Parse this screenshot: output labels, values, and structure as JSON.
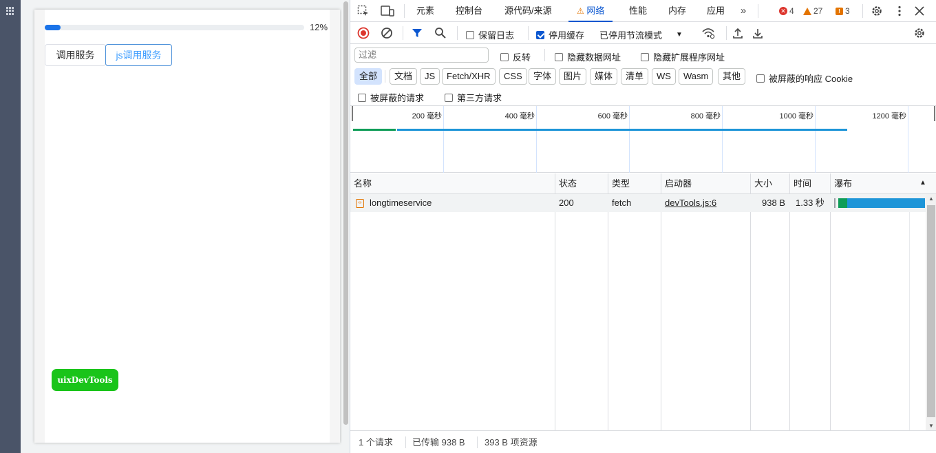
{
  "preview": {
    "progress": {
      "fraction": 0.12,
      "label": "12%"
    },
    "buttons": {
      "call_service": "调用服务",
      "js_call_service": "js调用服务"
    },
    "uix_button": "uixDevTools"
  },
  "devtools": {
    "tabs": [
      "元素",
      "控制台",
      "源代码/来源",
      "网络",
      "性能",
      "内存",
      "应用"
    ],
    "active_tab": "网络",
    "badges": {
      "errors": "4",
      "warnings": "27",
      "issues": "3"
    },
    "toolbar": {
      "preserve_log": "保留日志",
      "disable_cache": "停用缓存",
      "throttling": "已停用节流模式"
    },
    "filter": {
      "placeholder": "过滤",
      "invert": "反转",
      "hide_data_urls": "隐藏数据网址",
      "hide_extension_urls": "隐藏扩展程序网址",
      "chips": [
        "全部",
        "文档",
        "JS",
        "Fetch/XHR",
        "CSS",
        "字体",
        "图片",
        "媒体",
        "清单",
        "WS",
        "Wasm",
        "其他"
      ],
      "blocked_cookies": "被屏蔽的响应 Cookie",
      "blocked_requests": "被屏蔽的请求",
      "third_party": "第三方请求"
    },
    "timeline": {
      "ticks": [
        "200 毫秒",
        "400 毫秒",
        "600 毫秒",
        "800 毫秒",
        "1000 毫秒",
        "1200 毫秒"
      ]
    },
    "table": {
      "columns": {
        "name": "名称",
        "status": "状态",
        "type": "类型",
        "initiator": "启动器",
        "size": "大小",
        "time": "时间",
        "waterfall": "瀑布"
      },
      "rows": [
        {
          "name": "longtimeservice",
          "status": "200",
          "type": "fetch",
          "initiator": "devTools.js:6",
          "size": "938 B",
          "time": "1.33 秒"
        }
      ]
    },
    "status": {
      "requests": "1 个请求",
      "transferred": "已传输 938 B",
      "resources": "393 B 项资源"
    }
  },
  "colors": {
    "accent": "#0b57d0",
    "progress": "#1a73e8",
    "uix": "#1ac41a",
    "waterfall_wait": "#0f9d58",
    "waterfall_download": "#1e95d8"
  }
}
